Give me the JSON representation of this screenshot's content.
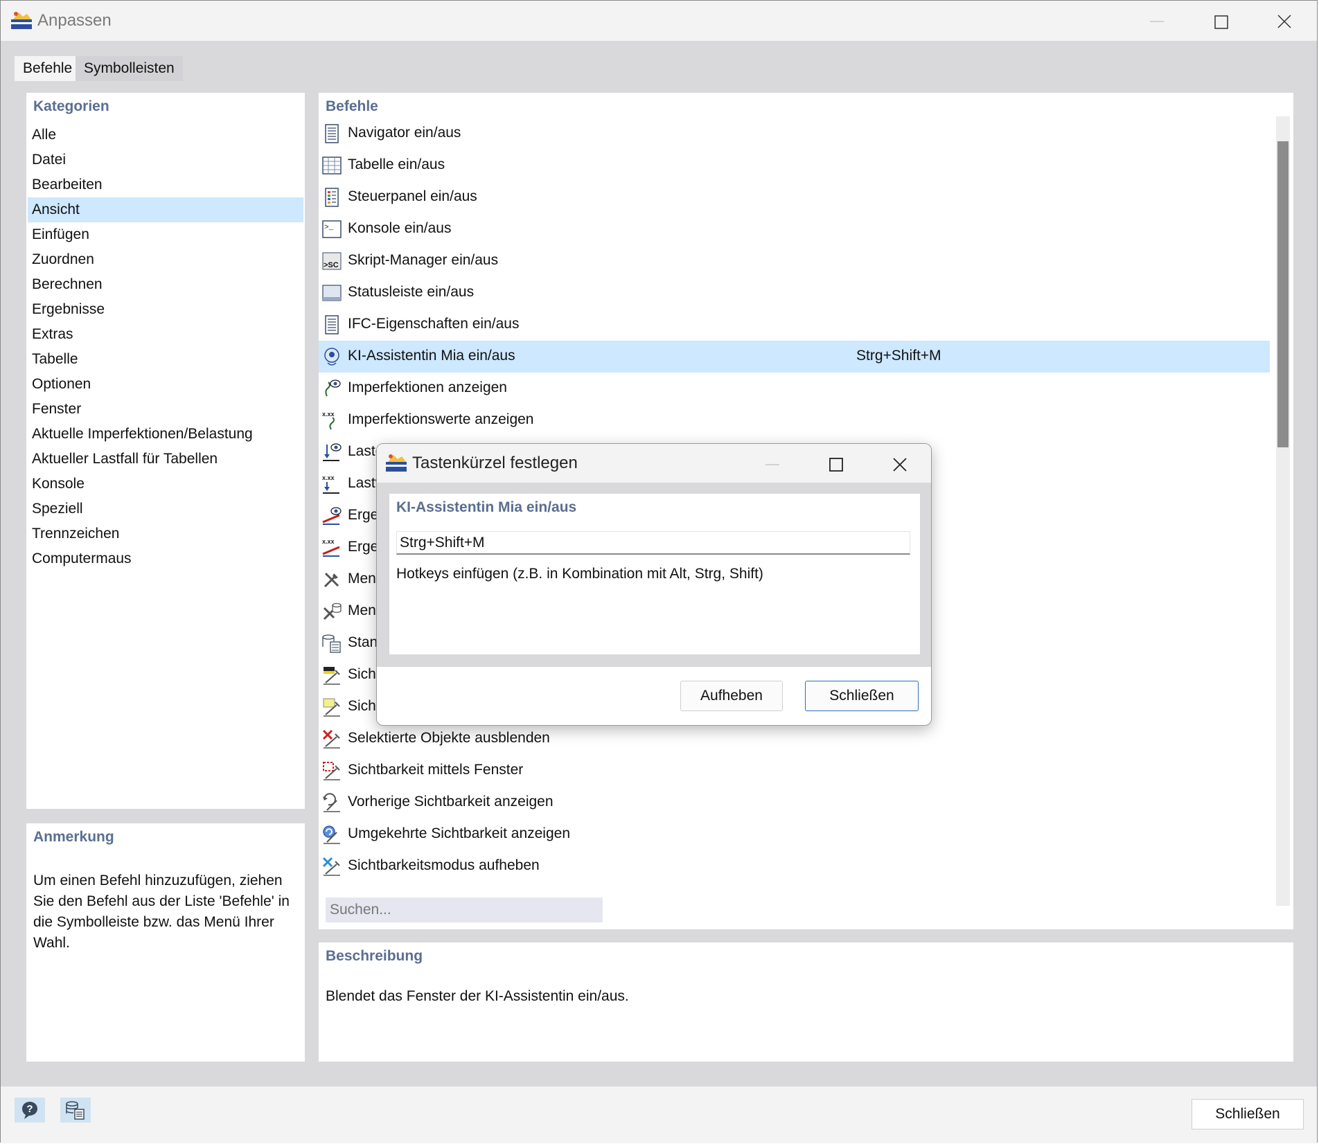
{
  "window": {
    "title": "Anpassen"
  },
  "tabs": [
    {
      "label": "Befehle",
      "active": true
    },
    {
      "label": "Symbolleisten",
      "active": false
    }
  ],
  "categories": {
    "heading": "Kategorien",
    "selected": "Ansicht",
    "items": [
      "Alle",
      "Datei",
      "Bearbeiten",
      "Ansicht",
      "Einfügen",
      "Zuordnen",
      "Berechnen",
      "Ergebnisse",
      "Extras",
      "Tabelle",
      "Optionen",
      "Fenster",
      "Aktuelle Imperfektionen/Belastung",
      "Aktueller Lastfall für Tabellen",
      "Konsole",
      "Speziell",
      "Trennzeichen",
      "Computermaus"
    ]
  },
  "note": {
    "heading": "Anmerkung",
    "text": "Um einen Befehl hinzuzufügen, ziehen Sie den Befehl aus der Liste 'Befehle' in die Symbolleiste bzw. das Menü Ihrer Wahl."
  },
  "commands": {
    "heading": "Befehle",
    "selected_index": 7,
    "items": [
      {
        "label": "Navigator ein/aus",
        "icon": "navigator-icon",
        "shortcut": ""
      },
      {
        "label": "Tabelle ein/aus",
        "icon": "table-icon",
        "shortcut": ""
      },
      {
        "label": "Steuerpanel ein/aus",
        "icon": "control-panel-icon",
        "shortcut": ""
      },
      {
        "label": "Konsole ein/aus",
        "icon": "console-icon",
        "shortcut": ""
      },
      {
        "label": "Skript-Manager ein/aus",
        "icon": "script-manager-icon",
        "shortcut": ""
      },
      {
        "label": "Statusleiste ein/aus",
        "icon": "statusbar-icon",
        "shortcut": ""
      },
      {
        "label": "IFC-Eigenschaften ein/aus",
        "icon": "ifc-properties-icon",
        "shortcut": ""
      },
      {
        "label": "KI-Assistentin Mia ein/aus",
        "icon": "ai-assistant-icon",
        "shortcut": "Strg+Shift+M"
      },
      {
        "label": "Imperfektionen anzeigen",
        "icon": "imperfections-icon",
        "shortcut": ""
      },
      {
        "label": "Imperfektionswerte anzeigen",
        "icon": "imperfection-values-icon",
        "shortcut": ""
      },
      {
        "label": "Laste",
        "icon": "loads-icon",
        "shortcut": ""
      },
      {
        "label": "Lastv",
        "icon": "load-values-icon",
        "shortcut": ""
      },
      {
        "label": "Erge",
        "icon": "results-icon",
        "shortcut": ""
      },
      {
        "label": "Erge",
        "icon": "result-values-icon",
        "shortcut": ""
      },
      {
        "label": "Men",
        "icon": "tools-icon",
        "shortcut": ""
      },
      {
        "label": "Men",
        "icon": "tools-db-icon",
        "shortcut": ""
      },
      {
        "label": "Stan",
        "icon": "standard-icon",
        "shortcut": ""
      },
      {
        "label": "Sicht",
        "icon": "visibility-icon",
        "shortcut": ""
      },
      {
        "label": "Sicht",
        "icon": "visibility-select-icon",
        "shortcut": ""
      },
      {
        "label": "Selektierte Objekte ausblenden",
        "icon": "hide-selected-icon",
        "shortcut": ""
      },
      {
        "label": "Sichtbarkeit mittels Fenster",
        "icon": "visibility-window-icon",
        "shortcut": ""
      },
      {
        "label": "Vorherige Sichtbarkeit anzeigen",
        "icon": "previous-visibility-icon",
        "shortcut": ""
      },
      {
        "label": "Umgekehrte Sichtbarkeit anzeigen",
        "icon": "inverse-visibility-icon",
        "shortcut": ""
      },
      {
        "label": "Sichtbarkeitsmodus aufheben",
        "icon": "cancel-visibility-icon",
        "shortcut": ""
      }
    ]
  },
  "search": {
    "placeholder": "Suchen..."
  },
  "description": {
    "heading": "Beschreibung",
    "text": "Blendet das Fenster der KI-Assistentin ein/aus."
  },
  "footer": {
    "help_icon": "help-icon",
    "database_icon": "database-icon",
    "close_label": "Schließen"
  },
  "dialog": {
    "title": "Tastenkürzel festlegen",
    "command_name": "KI-Assistentin Mia ein/aus",
    "hotkey_value": "Strg+Shift+M",
    "hint": "Hotkeys einfügen (z.B. in Kombination mit Alt, Strg, Shift)",
    "cancel_label": "Aufheben",
    "close_label": "Schließen"
  },
  "colors": {
    "accent_heading": "#5a6e90",
    "selection": "#cde8ff",
    "primary_border": "#2a6fbf"
  }
}
